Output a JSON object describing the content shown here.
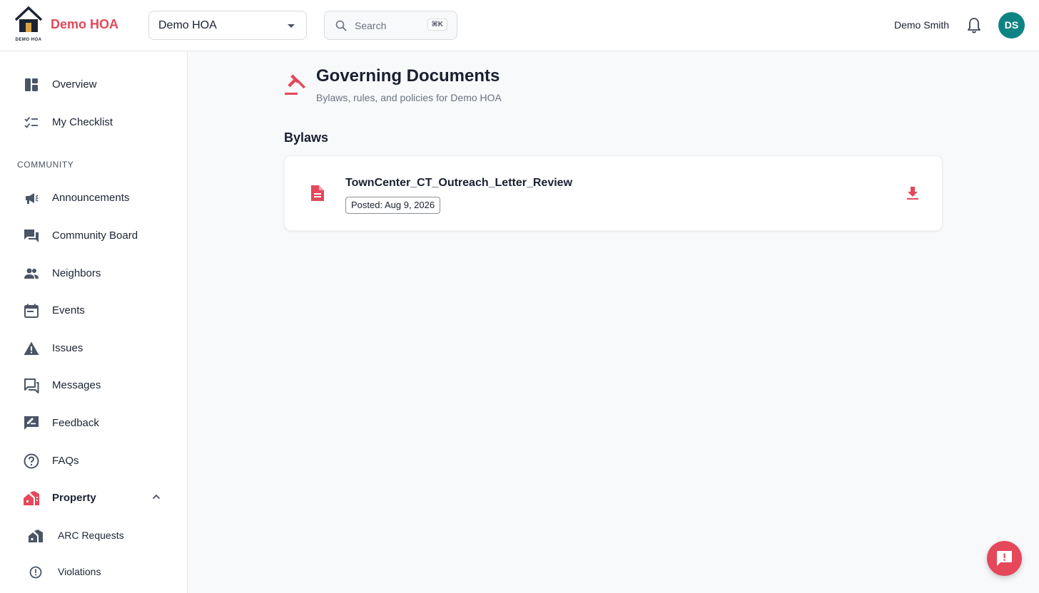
{
  "header": {
    "logo_caption": "DEMO HOA",
    "brand": "Demo HOA",
    "hoa_select": "Demo HOA",
    "search_placeholder": "Search",
    "search_shortcut": "⌘K",
    "user_name": "Demo Smith",
    "avatar_initials": "DS"
  },
  "sidebar": {
    "top_items": [
      {
        "label": "Overview",
        "icon": "dashboard-icon"
      },
      {
        "label": "My Checklist",
        "icon": "checklist-icon"
      }
    ],
    "section_label": "COMMUNITY",
    "community_items": [
      {
        "label": "Announcements",
        "icon": "megaphone-icon"
      },
      {
        "label": "Community Board",
        "icon": "forum-icon"
      },
      {
        "label": "Neighbors",
        "icon": "people-icon"
      },
      {
        "label": "Events",
        "icon": "calendar-icon"
      },
      {
        "label": "Issues",
        "icon": "warning-icon"
      },
      {
        "label": "Messages",
        "icon": "messages-icon"
      },
      {
        "label": "Feedback",
        "icon": "feedback-icon"
      },
      {
        "label": "FAQs",
        "icon": "help-icon"
      },
      {
        "label": "Property",
        "icon": "property-icon"
      }
    ],
    "property_sub_items": [
      {
        "label": "ARC Requests",
        "icon": "arc-icon"
      },
      {
        "label": "Violations",
        "icon": "alert-circle-icon"
      }
    ]
  },
  "main": {
    "title": "Governing Documents",
    "subtitle": "Bylaws, rules, and policies for Demo HOA",
    "section": "Bylaws",
    "document": {
      "name": "TownCenter_CT_Outreach_Letter_Review",
      "posted": "Posted: Aug 9, 2026"
    }
  },
  "colors": {
    "brand": "#e4485a",
    "avatar": "#0e8384",
    "nav_icon": "#4a5566"
  }
}
